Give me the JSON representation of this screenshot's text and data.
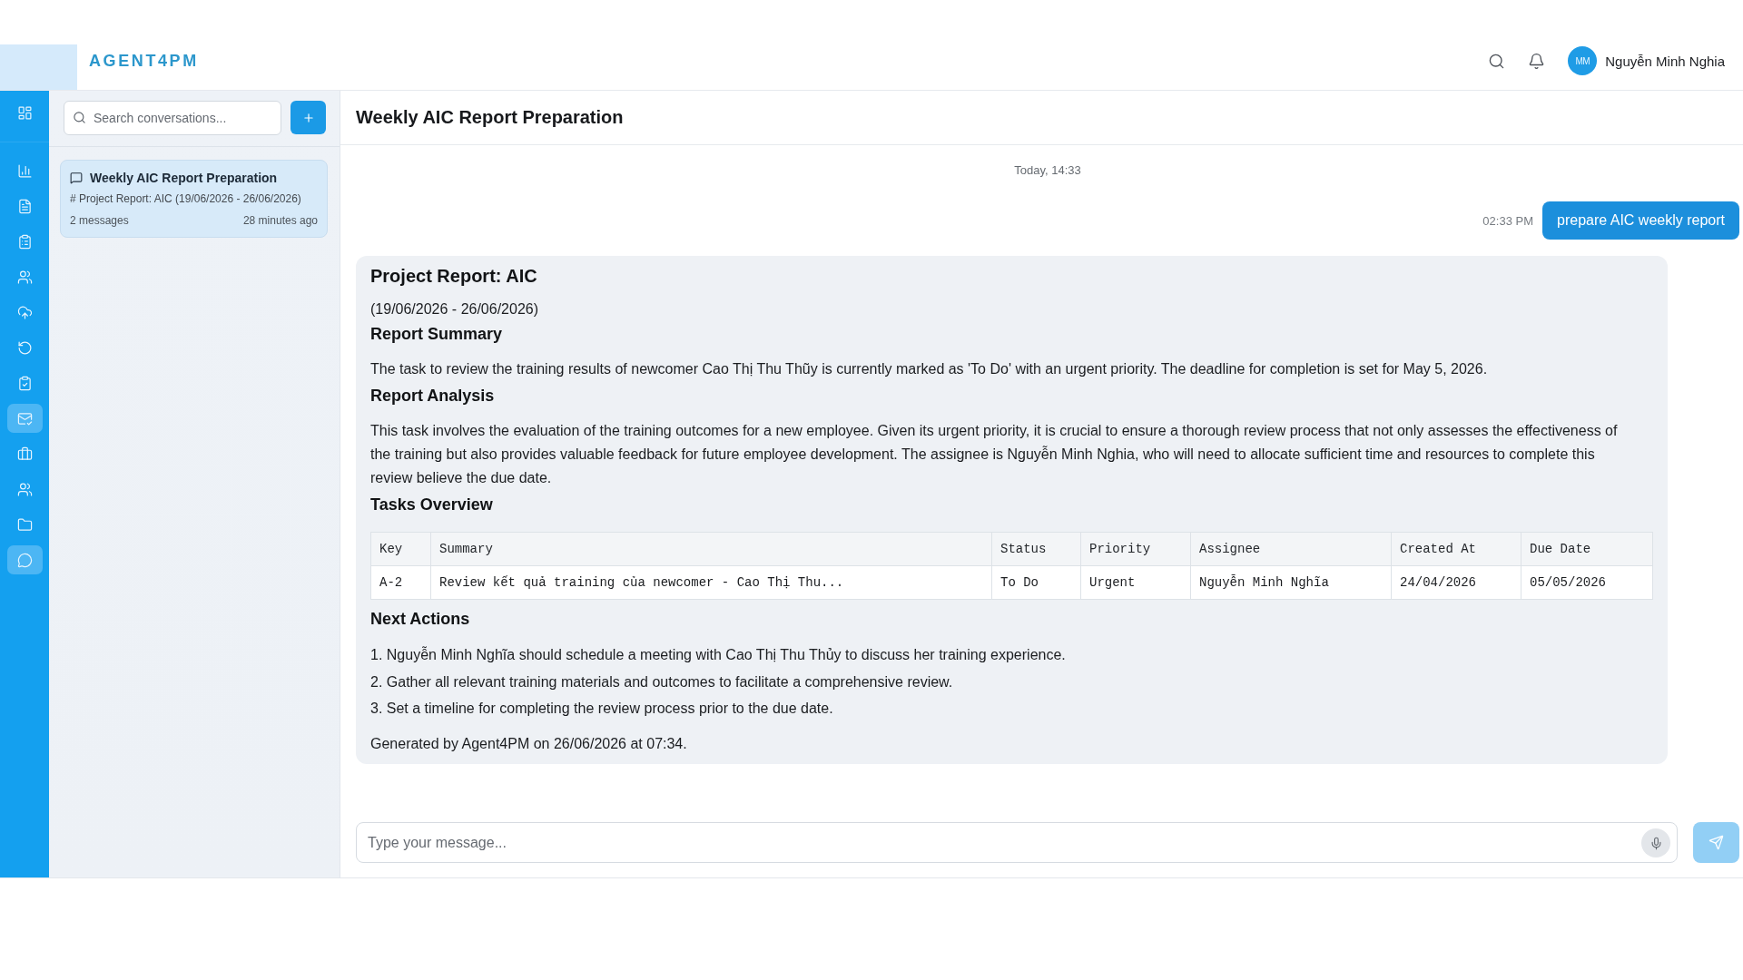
{
  "header": {
    "logo": "AGENT4PM",
    "user": {
      "initials": "MM",
      "name": "Nguyễn Minh Nghia"
    }
  },
  "sidebar": {
    "items": [
      {
        "selected": false
      },
      {
        "selected": false
      },
      {
        "selected": false
      },
      {
        "selected": false
      },
      {
        "selected": false
      },
      {
        "selected": false
      },
      {
        "selected": false
      },
      {
        "selected": false
      },
      {
        "selected": true
      },
      {
        "selected": false
      },
      {
        "selected": false
      },
      {
        "selected": false
      },
      {
        "selected": true
      }
    ]
  },
  "conversations": {
    "search": {
      "placeholder": "Search conversations..."
    },
    "items": [
      {
        "title": "Weekly AIC Report Preparation",
        "preview": "# Project Report: AIC (19/06/2026 - 26/06/2026)",
        "count": "2 messages",
        "time": "28 minutes ago",
        "selected": true
      }
    ]
  },
  "chat": {
    "title": "Weekly AIC Report Preparation",
    "date_label": "Today, 14:33",
    "messages": [
      {
        "kind": "user",
        "time": "02:33 PM",
        "text": "prepare AIC weekly report"
      },
      {
        "kind": "assistant",
        "blocks": [
          {
            "kind": "title",
            "text": "Project Report: AIC"
          },
          {
            "kind": "date",
            "text": "(19/06/2026 - 26/06/2026)"
          },
          {
            "kind": "heading",
            "text": "Report Summary"
          },
          {
            "kind": "paragraph",
            "text": "The task to review the training results of newcomer Cao Thị Thu Thũy is currently marked as 'To Do' with an urgent priority. The deadline for completion is set for May 5, 2026."
          },
          {
            "kind": "heading",
            "text": "Report Analysis"
          },
          {
            "kind": "paragraph",
            "text": "This task involves the evaluation of the training outcomes for a new employee. Given its urgent priority, it is crucial to ensure a thorough review process that not only assesses the effectiveness of the training but also provides valuable feedback for future employee development. The assignee is Nguyễn Minh Nghia, who will need to allocate sufficient time and resources to complete this review believe the due date."
          },
          {
            "kind": "heading",
            "text": "Tasks Overview"
          },
          {
            "kind": "table",
            "columns": [
              "Key",
              "Summary",
              "Status",
              "Priority",
              "Assignee",
              "Created At",
              "Due Date"
            ],
            "rows": [
              [
                "A-2",
                "Review kết quả training của newcomer - Cao Thị Thu...",
                "To Do",
                "Urgent",
                "Nguyễn Minh Nghĩa",
                "24/04/2026",
                "05/05/2026"
              ]
            ]
          },
          {
            "kind": "heading",
            "text": "Next Actions"
          },
          {
            "kind": "list",
            "items": [
              "1. Nguyễn Minh Nghĩa should schedule a meeting with Cao Thị Thu Thủy to discuss her training experience.",
              "2. Gather all relevant training materials and outcomes to facilitate a comprehensive review.",
              "3. Set a timeline for completing the review process prior to the due date."
            ]
          },
          {
            "kind": "note",
            "text": "Generated by Agent4PM on 26/06/2026 at 07:34."
          }
        ]
      }
    ],
    "composer": {
      "placeholder": "Type your message...",
      "send_disabled": true
    }
  }
}
